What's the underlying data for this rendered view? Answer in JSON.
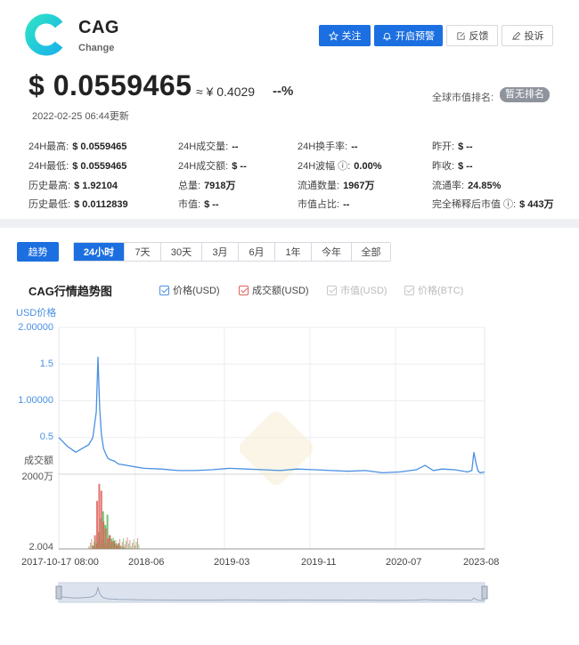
{
  "coin": {
    "name": "CAG",
    "subtitle": "Change",
    "price_usd": "$ 0.0559465",
    "price_cny": "≈ ¥ 0.4029",
    "change": "--%",
    "updated": "2022-02-25 06:44更新",
    "rank_label": "全球市值排名:",
    "rank_value": "暂无排名"
  },
  "actions": {
    "follow": "关注",
    "alert": "开启预警",
    "feedback": "反馈",
    "complain": "投诉"
  },
  "stats": [
    [
      {
        "label": "24H最高:",
        "value": "$ 0.0559465"
      },
      {
        "label": "24H成交量:",
        "value": "--"
      },
      {
        "label": "24H换手率:",
        "value": "--"
      },
      {
        "label": "昨开:",
        "value": "$ --"
      }
    ],
    [
      {
        "label": "24H最低:",
        "value": "$ 0.0559465"
      },
      {
        "label": "24H成交额:",
        "value": "$ --"
      },
      {
        "label": "24H波幅 ⓘ:",
        "value": "0.00%"
      },
      {
        "label": "昨收:",
        "value": "$ --"
      }
    ],
    [
      {
        "label": "历史最高:",
        "value": "$ 1.92104"
      },
      {
        "label": "总量:",
        "value": "7918万"
      },
      {
        "label": "流通数量:",
        "value": "1967万"
      },
      {
        "label": "流通率:",
        "value": "24.85%"
      }
    ],
    [
      {
        "label": "历史最低:",
        "value": "$ 0.0112839"
      },
      {
        "label": "市值:",
        "value": "$ --"
      },
      {
        "label": "市值占比:",
        "value": "--"
      },
      {
        "label": "完全稀释后市值 ⓘ:",
        "value": "$ 443万"
      }
    ]
  ],
  "tabs": {
    "trend": "趋势",
    "ranges": [
      "24小时",
      "7天",
      "30天",
      "3月",
      "6月",
      "1年",
      "今年",
      "全部"
    ],
    "active_index": 0
  },
  "chart_title": "CAG行情趋势图",
  "legend": [
    {
      "name": "价格(USD)",
      "color": "#4a90e2",
      "enabled": true
    },
    {
      "name": "成交额(USD)",
      "color": "#e0605a",
      "enabled": true
    },
    {
      "name": "市值(USD)",
      "color": "#c8c8c8",
      "enabled": false
    },
    {
      "name": "价格(BTC)",
      "color": "#c8c8c8",
      "enabled": false
    }
  ],
  "colors": {
    "accent": "#1c6fe0",
    "price_line": "#4a90e2",
    "volume_red": "#e0605a",
    "volume_green": "#5cb85c"
  },
  "chart_data": {
    "type": "line",
    "y_unit_label": "USD价格",
    "y_ticks": [
      "2.00000",
      "1.5",
      "1.00000",
      "0.5"
    ],
    "ylim": [
      0,
      2
    ],
    "volume_labels": [
      "成交额",
      "2000万",
      "2.004"
    ],
    "x_tick_labels": [
      "2017-10-17 08:00",
      "2018-06",
      "2019-03",
      "2019-11",
      "2020-07",
      "2023-08"
    ],
    "price_series": {
      "name": "价格(USD)",
      "x": [
        0,
        0.02,
        0.04,
        0.055,
        0.07,
        0.08,
        0.088,
        0.092,
        0.096,
        0.1,
        0.105,
        0.11,
        0.115,
        0.12,
        0.13,
        0.14,
        0.16,
        0.18,
        0.2,
        0.24,
        0.28,
        0.32,
        0.36,
        0.4,
        0.44,
        0.48,
        0.52,
        0.56,
        0.6,
        0.64,
        0.68,
        0.72,
        0.76,
        0.8,
        0.84,
        0.86,
        0.88,
        0.9,
        0.93,
        0.96,
        0.97,
        0.975,
        0.98,
        0.985,
        0.99,
        1.0
      ],
      "y": [
        0.5,
        0.38,
        0.3,
        0.35,
        0.4,
        0.5,
        0.85,
        1.6,
        0.9,
        0.55,
        0.35,
        0.28,
        0.22,
        0.2,
        0.18,
        0.14,
        0.12,
        0.1,
        0.08,
        0.07,
        0.05,
        0.05,
        0.06,
        0.08,
        0.07,
        0.06,
        0.05,
        0.07,
        0.06,
        0.05,
        0.04,
        0.05,
        0.02,
        0.03,
        0.06,
        0.12,
        0.05,
        0.07,
        0.06,
        0.03,
        0.05,
        0.3,
        0.15,
        0.04,
        0.02,
        0.03
      ]
    },
    "volume_series": {
      "name": "成交额(USD)",
      "x": [
        0.08,
        0.085,
        0.09,
        0.095,
        0.1,
        0.105,
        0.11,
        0.115,
        0.12,
        0.125,
        0.13,
        0.135,
        0.14,
        0.15
      ],
      "red": [
        0.05,
        0.2,
        0.7,
        0.95,
        0.85,
        0.4,
        0.3,
        0.15,
        0.2,
        0.1,
        0.12,
        0.06,
        0.08,
        0.03
      ],
      "green": [
        0.03,
        0.08,
        0.25,
        0.45,
        0.55,
        0.35,
        0.5,
        0.2,
        0.15,
        0.12,
        0.08,
        0.05,
        0.04,
        0.02
      ]
    }
  }
}
